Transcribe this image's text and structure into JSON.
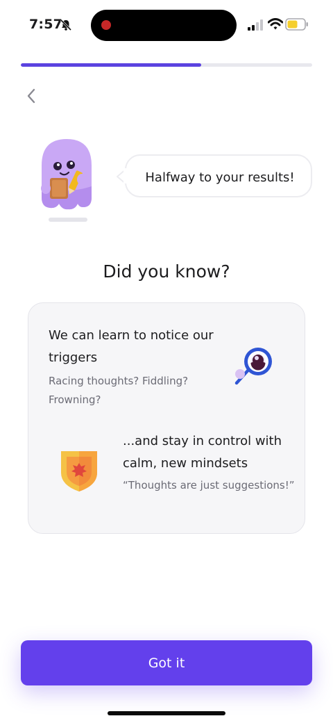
{
  "status_bar": {
    "time": "7:57",
    "icons": [
      "bell-slash-icon",
      "cellular-signal-icon",
      "wifi-icon",
      "battery-icon"
    ]
  },
  "progress": {
    "value": 0.62
  },
  "nav": {
    "back_icon": "chevron-left-icon"
  },
  "mascot": {
    "speech": "Halfway to your results!"
  },
  "heading": "Did you know?",
  "card": {
    "item1": {
      "title": "We can learn to notice our triggers",
      "subtitle": "Racing thoughts? Fiddling? Frowning?",
      "icon": "magnifier-icon"
    },
    "item2": {
      "title": "...and stay in control with calm, new mindsets",
      "subtitle": "“Thoughts are just suggestions!”",
      "icon": "shield-icon"
    }
  },
  "cta": {
    "label": "Got it"
  },
  "colors": {
    "accent": "#6340ec",
    "progress": "#5b43e0",
    "card_bg": "#f6f6f8",
    "mascot": "#c9a8f5"
  }
}
